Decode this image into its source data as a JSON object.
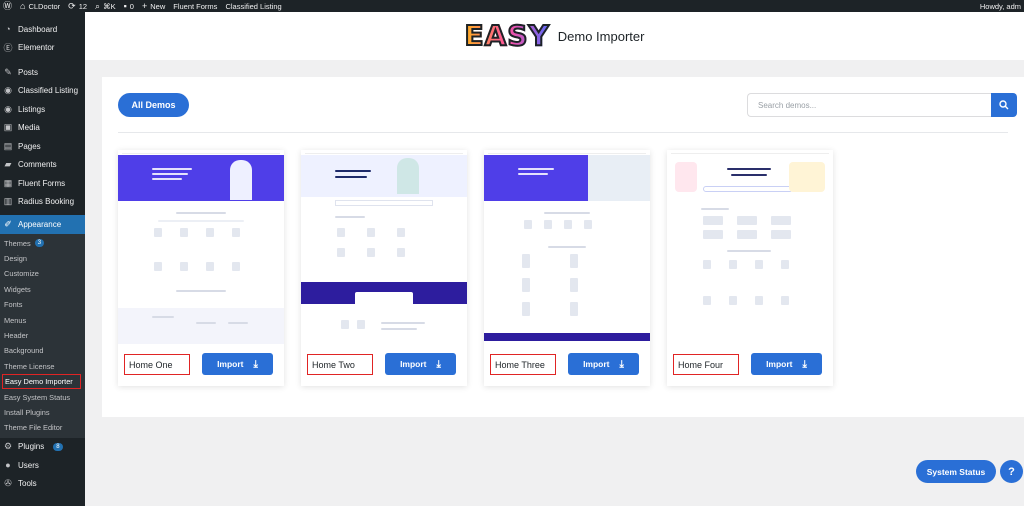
{
  "adminbar": {
    "site_name": "CLDoctor",
    "updates_count": "12",
    "shortcut": "⌘K",
    "comments_count": "0",
    "new_label": "New",
    "links": [
      "Fluent Forms",
      "Classified Listing"
    ],
    "howdy": "Howdy, adm"
  },
  "sidebar": {
    "top": [
      {
        "label": "Dashboard",
        "icon": "dashboard-icon"
      },
      {
        "label": "Elementor",
        "icon": "elementor-icon"
      },
      {
        "label": "Posts",
        "icon": "pin-icon"
      },
      {
        "label": "Classified Listing",
        "icon": "location-icon"
      },
      {
        "label": "Listings",
        "icon": "location-icon"
      },
      {
        "label": "Media",
        "icon": "media-icon"
      },
      {
        "label": "Pages",
        "icon": "page-icon"
      },
      {
        "label": "Comments",
        "icon": "comment-icon"
      },
      {
        "label": "Fluent Forms",
        "icon": "form-icon"
      },
      {
        "label": "Radius Booking",
        "icon": "booking-icon"
      }
    ],
    "appearance": {
      "label": "Appearance",
      "icon": "brush-icon"
    },
    "submenu": [
      {
        "label": "Themes",
        "badge": "3"
      },
      {
        "label": "Design"
      },
      {
        "label": "Customize"
      },
      {
        "label": "Widgets"
      },
      {
        "label": "Fonts"
      },
      {
        "label": "Menus"
      },
      {
        "label": "Header"
      },
      {
        "label": "Background"
      },
      {
        "label": "Theme License"
      },
      {
        "label": "Easy Demo Importer"
      },
      {
        "label": "Easy System Status"
      },
      {
        "label": "Install Plugins"
      },
      {
        "label": "Theme File Editor"
      }
    ],
    "bottom": [
      {
        "label": "Plugins",
        "icon": "plugin-icon",
        "badge": "8"
      },
      {
        "label": "Users",
        "icon": "user-icon"
      },
      {
        "label": "Tools",
        "icon": "wrench-icon"
      }
    ]
  },
  "header": {
    "logo_text": "EASY",
    "title": "Demo Importer"
  },
  "toolbar": {
    "all_demos_label": "All Demos",
    "search_placeholder": "Search demos..."
  },
  "demos": [
    {
      "name": "Home One",
      "import_label": "Import"
    },
    {
      "name": "Home Two",
      "import_label": "Import"
    },
    {
      "name": "Home Three",
      "import_label": "Import"
    },
    {
      "name": "Home Four",
      "import_label": "Import"
    }
  ],
  "footer": {
    "system_status_label": "System Status",
    "help_label": "?"
  },
  "colors": {
    "accent": "#2a6fd6",
    "sidebar_bg": "#1d2327",
    "highlight_border": "#e02424",
    "hero": "#4f3ee8"
  }
}
